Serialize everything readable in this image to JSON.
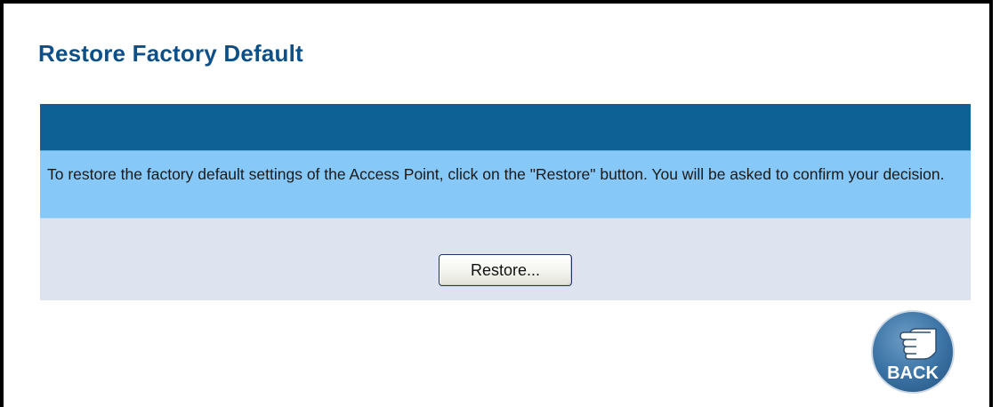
{
  "page": {
    "title": "Restore Factory Default"
  },
  "panel": {
    "description": "To restore the factory default settings of the Access Point, click on the \"Restore\" button. You will be asked to confirm your decision.",
    "restore_label": "Restore..."
  },
  "back": {
    "label": "BACK",
    "icon": "pointing-hand-icon"
  },
  "colors": {
    "title": "#0e4f87",
    "header_bar": "#0e6194",
    "description_bg": "#86c8f8",
    "actions_bg": "#dee4ef",
    "back_circle": "#3d76a8"
  }
}
